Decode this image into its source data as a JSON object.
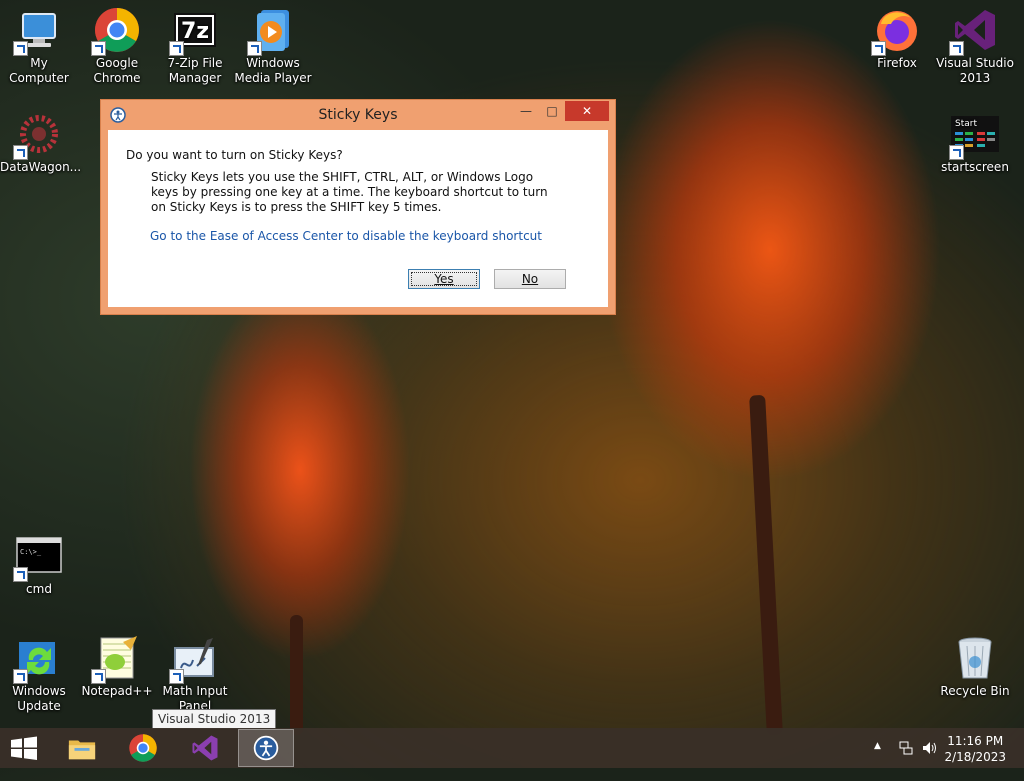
{
  "desktop": {
    "icons": [
      {
        "id": "my-computer",
        "label": "My Computer",
        "icon": "computer-icon"
      },
      {
        "id": "google-chrome",
        "label": "Google Chrome",
        "icon": "chrome-icon"
      },
      {
        "id": "7zip",
        "label": "7-Zip File Manager",
        "icon": "7zip-icon"
      },
      {
        "id": "wmp",
        "label": "Windows Media Player",
        "icon": "media-player-icon"
      },
      {
        "id": "firefox",
        "label": "Firefox",
        "icon": "firefox-icon"
      },
      {
        "id": "visual-studio",
        "label": "Visual Studio 2013",
        "icon": "visual-studio-icon"
      },
      {
        "id": "datawagon",
        "label": "DataWagon...",
        "icon": "datawagon-icon"
      },
      {
        "id": "startscreen",
        "label": "startscreen",
        "icon": "startscreen-icon",
        "icon_text": "Start"
      },
      {
        "id": "cmd",
        "label": "cmd",
        "icon": "cmd-icon",
        "icon_text": "C:\\>_"
      },
      {
        "id": "windows-update",
        "label": "Windows Update",
        "icon": "windows-update-icon"
      },
      {
        "id": "notepad-pp",
        "label": "Notepad++",
        "icon": "notepadpp-icon"
      },
      {
        "id": "math-input",
        "label": "Math Input Panel",
        "icon": "math-input-icon"
      },
      {
        "id": "recycle-bin",
        "label": "Recycle Bin",
        "icon": "recycle-bin-icon"
      }
    ]
  },
  "dialog": {
    "title": "Sticky Keys",
    "minimize": "—",
    "maximize": "□",
    "close": "✕",
    "question": "Do you want to turn on Sticky Keys?",
    "description": "Sticky Keys lets you use the SHIFT, CTRL, ALT, or Windows Logo keys by pressing one key at a time. The keyboard shortcut to turn on Sticky Keys is to press the SHIFT key 5 times.",
    "link": "Go to the Ease of Access Center to disable the keyboard shortcut",
    "yes": "Yes",
    "no": "No"
  },
  "tooltip": "Visual Studio 2013",
  "taskbar": {
    "items": [
      "file-explorer-icon",
      "chrome-icon",
      "visual-studio-icon",
      "ease-of-access-icon"
    ],
    "active_item": "ease-of-access-icon",
    "time": "11:16 PM",
    "date": "2/18/2023"
  },
  "colors": {
    "dialog_frame": "#f0a070",
    "close_button": "#c7392b",
    "link": "#1a56a8",
    "taskbar": "#3a3028"
  }
}
